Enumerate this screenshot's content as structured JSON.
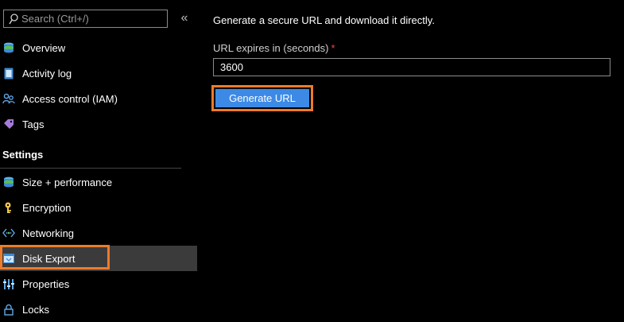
{
  "search": {
    "placeholder": "Search (Ctrl+/)",
    "collapse_glyph": "«"
  },
  "sidebar": {
    "items": [
      {
        "label": "Overview",
        "icon": "disk-icon"
      },
      {
        "label": "Activity log",
        "icon": "activity-log-icon"
      },
      {
        "label": "Access control (IAM)",
        "icon": "people-icon"
      },
      {
        "label": "Tags",
        "icon": "tag-icon"
      }
    ],
    "settings_header": "Settings",
    "settings_items": [
      {
        "label": "Size + performance",
        "icon": "disk-icon"
      },
      {
        "label": "Encryption",
        "icon": "key-icon"
      },
      {
        "label": "Networking",
        "icon": "network-icon"
      },
      {
        "label": "Disk Export",
        "icon": "disk-export-icon",
        "selected": true
      },
      {
        "label": "Properties",
        "icon": "properties-icon"
      },
      {
        "label": "Locks",
        "icon": "lock-icon"
      }
    ]
  },
  "main": {
    "description": "Generate a secure URL and download it directly.",
    "expires_label": "URL expires in (seconds)",
    "required_marker": "*",
    "expires_value": "3600",
    "generate_button": "Generate URL"
  },
  "colors": {
    "accent": "#3c8ae6",
    "highlight": "#ec7c2c",
    "required": "#e84a3b",
    "selected_bg": "#3b3b3b"
  }
}
